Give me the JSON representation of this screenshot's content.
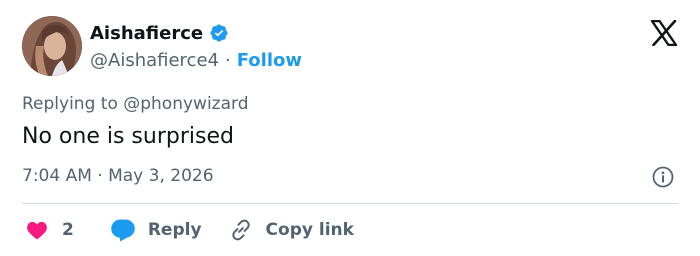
{
  "author": {
    "display_name": "Aishafierce",
    "handle": "@Aishafierce4",
    "separator": "·",
    "follow_label": "Follow",
    "verified": true,
    "verified_color": "#1d9bf0"
  },
  "brand": {
    "logo_icon": "x-logo-icon"
  },
  "tweet": {
    "replying_to": "Replying to @phonywizard",
    "text": "No one is surprised",
    "timestamp": "7:04 AM · May 3, 2026"
  },
  "actions": {
    "like_count": "2",
    "like_color": "#f91880",
    "reply_label": "Reply",
    "reply_color": "#1d9bf0",
    "copy_link_label": "Copy link"
  },
  "colors": {
    "text_primary": "#0f1419",
    "text_secondary": "#536471",
    "accent": "#1d9bf0",
    "divider": "#cfd9de"
  }
}
